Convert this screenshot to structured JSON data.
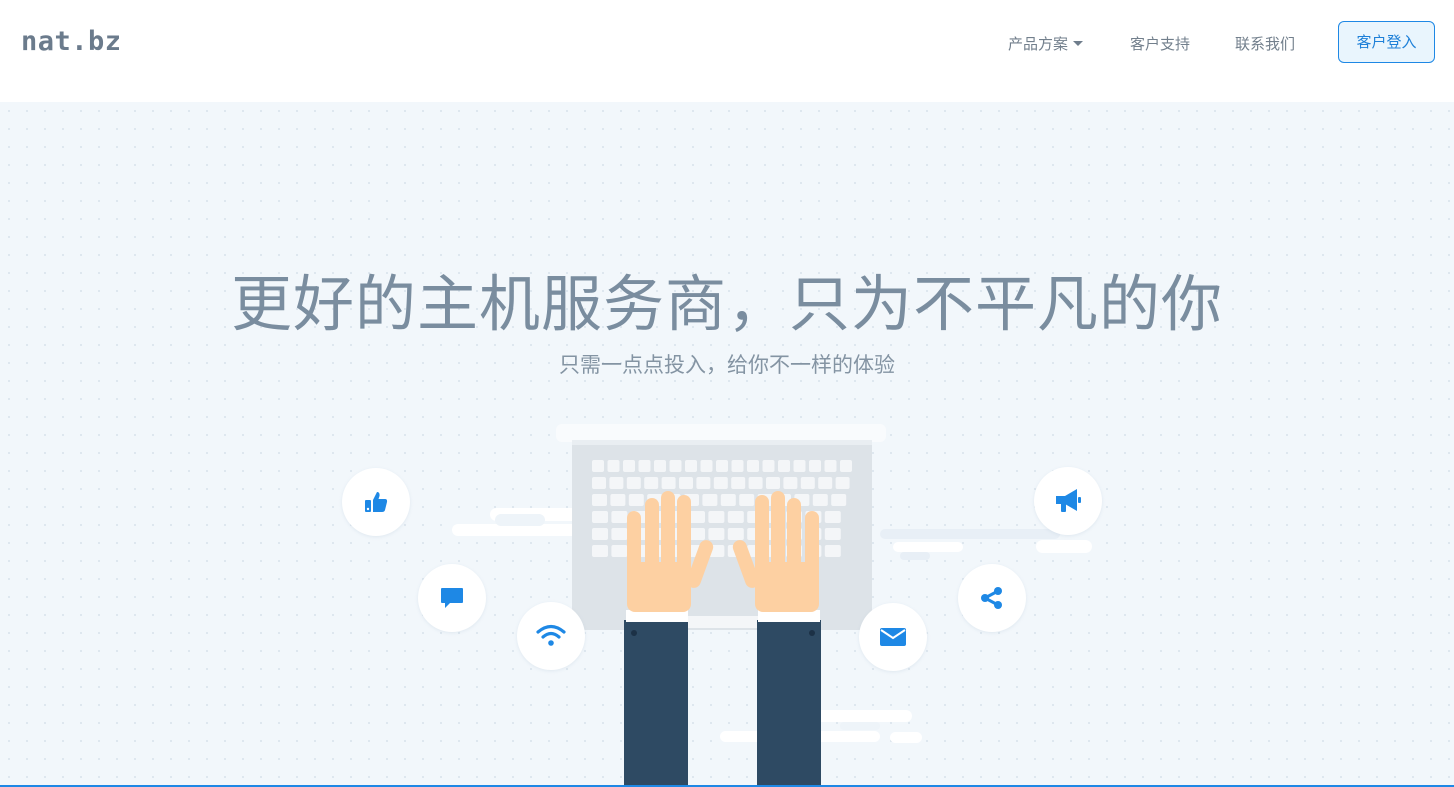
{
  "header": {
    "logo": "nat.bz",
    "nav": {
      "products": "产品方案",
      "support": "客户支持",
      "contact": "联系我们"
    },
    "login_label": "客户登入"
  },
  "hero": {
    "title": "更好的主机服务商，只为不平凡的你",
    "subtitle": "只需一点点投入，给你不一样的体验"
  },
  "icons": {
    "like": "thumbs-up-icon",
    "chat": "comment-icon",
    "wifi": "wifi-icon",
    "announce": "megaphone-icon",
    "share": "share-icon",
    "mail": "envelope-icon"
  },
  "colors": {
    "accent": "#1e88e5",
    "hero_bg": "#f2f7fb",
    "sleeve": "#2e4a63",
    "skin": "#fdd0a2",
    "laptop": "#dde3e8"
  }
}
